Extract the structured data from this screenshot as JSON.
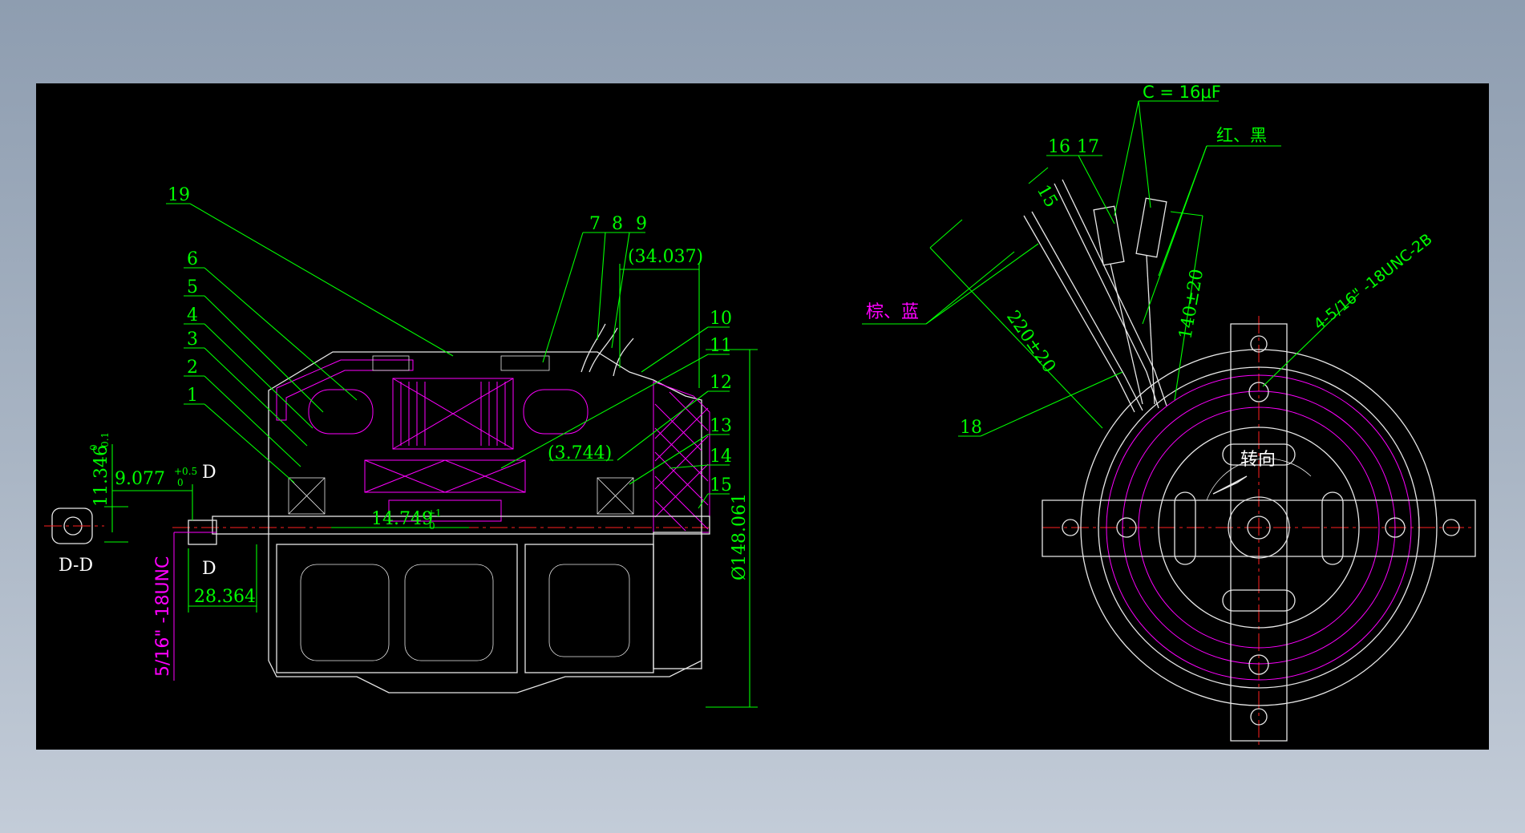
{
  "colors": {
    "background": "#000000",
    "leader": "#00ff00",
    "geometry": "#e8e8e8",
    "winding": "#ff00ff",
    "center_line": "#ff2020",
    "frame": "#98a6b8"
  },
  "balloons": [
    "19",
    "6",
    "5",
    "4",
    "3",
    "2",
    "1",
    "7",
    "8",
    "9",
    "10",
    "11",
    "12",
    "13",
    "14",
    "15",
    "16",
    "17",
    "18"
  ],
  "dimensions": {
    "d_11346": "11.346",
    "d_11346_tol_up": "0",
    "d_11346_tol_dn": "-0.1",
    "d_9077": "9.077",
    "d_9077_tol_up": "+0.5",
    "d_9077_tol_dn": "0",
    "d_34037": "(34.037)",
    "d_3744": "(3.744)",
    "d_14749": "14.749",
    "d_14749_tol_up": "+1",
    "d_14749_tol_dn": "0",
    "d_28364": "28.364",
    "d_148061": "Ø148.061",
    "d_220": "220±20",
    "d_140": "140±20",
    "d_15": "15"
  },
  "labels": {
    "section_d": "D",
    "section_dd": "D-D",
    "thread_shaft": "5/16\" -18UNC",
    "thread_holes": "4-5/16\" -18UNC-2B",
    "capacitor": "C = 16μF",
    "wire_red_black": "红、黑",
    "wire_brown_blue": "棕、蓝",
    "rotation": "转向"
  }
}
